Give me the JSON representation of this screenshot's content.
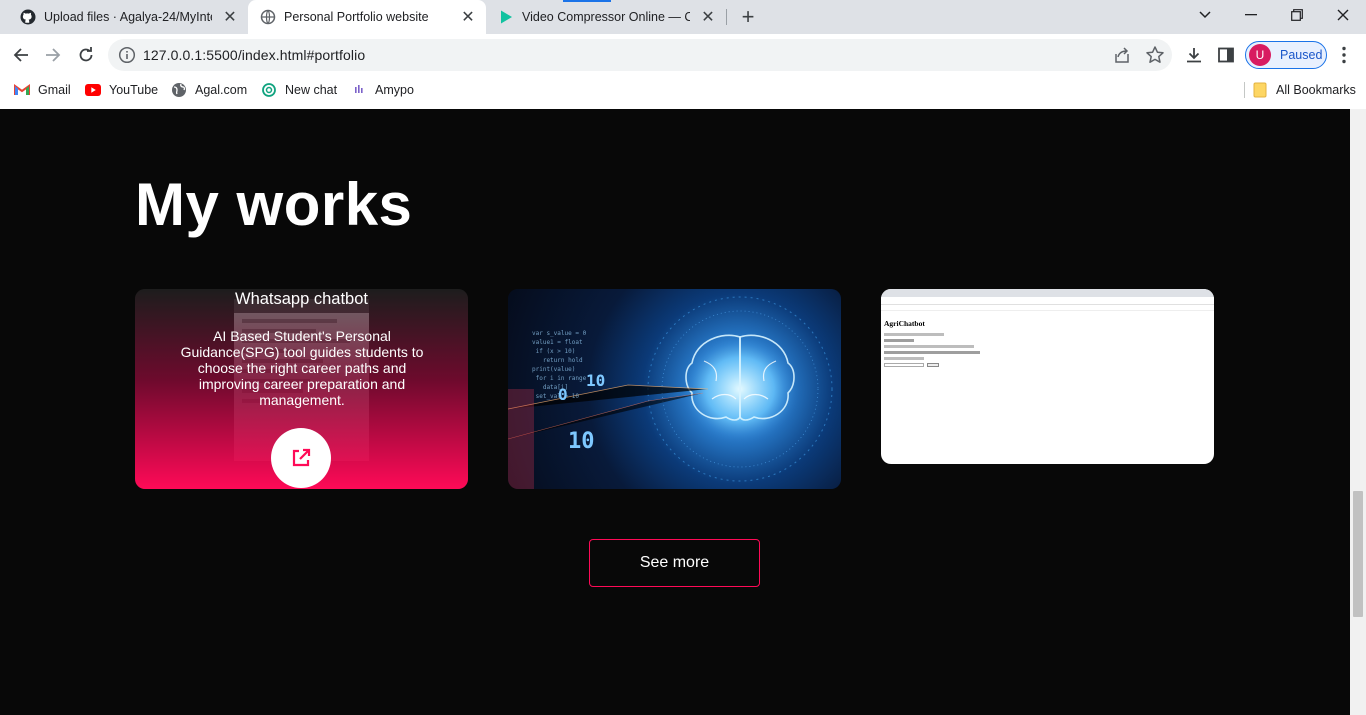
{
  "browser": {
    "tabs": [
      {
        "title": "Upload files · Agalya-24/MyInter",
        "icon": "github-icon",
        "active": false
      },
      {
        "title": "Personal Portfolio website",
        "icon": "globe-icon",
        "active": true
      },
      {
        "title": "Video Compressor Online — Clic",
        "icon": "play-icon",
        "active": false
      }
    ],
    "url": "127.0.0.1:5500/index.html#portfolio",
    "profile": {
      "initial": "U",
      "status": "Paused"
    },
    "bookmarks": [
      {
        "label": "Gmail",
        "icon": "gmail-icon"
      },
      {
        "label": "YouTube",
        "icon": "youtube-icon"
      },
      {
        "label": "Agal.com",
        "icon": "globe-icon"
      },
      {
        "label": "New chat",
        "icon": "chatgpt-icon"
      },
      {
        "label": "Amypo",
        "icon": "amypo-icon"
      }
    ],
    "all_bookmarks": "All Bookmarks"
  },
  "page": {
    "section_title": "My works",
    "works": [
      {
        "title": "Whatsapp chatbot",
        "description": "AI Based Student's Personal Guidance(SPG) tool guides students to choose the right career paths and improving career preparation and management."
      },
      {
        "title": "",
        "description": ""
      },
      {
        "title": "",
        "description": "",
        "screenshot_heading": "AgriChatbot"
      }
    ],
    "see_more": "See more"
  },
  "colors": {
    "accent": "#ff0a57",
    "background": "#080808"
  }
}
